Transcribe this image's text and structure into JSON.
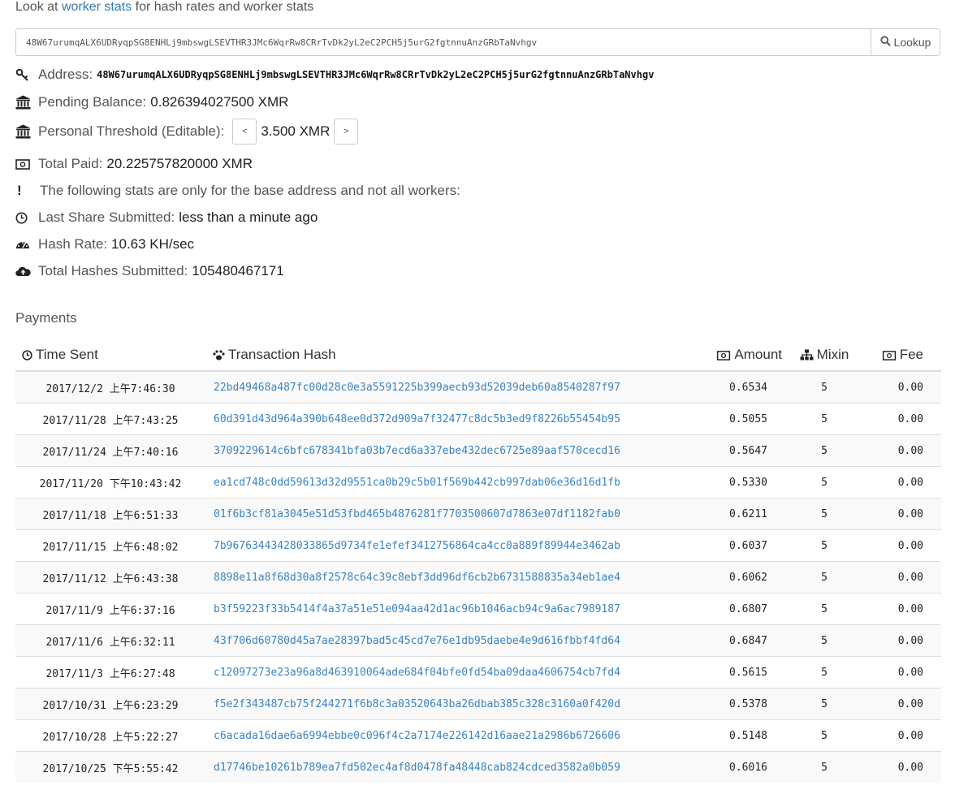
{
  "intro": {
    "prefix": "Look at ",
    "link": "worker stats",
    "suffix": " for hash rates and worker stats"
  },
  "lookup": {
    "value": "48W67urumqALX6UDRyqpSG8ENHLj9mbswgLSEVTHR3JMc6WqrRw8CRrTvDk2yL2eC2PCH5j5urG2fgtnnuAnzGRbTaNvhgv",
    "button_label": "Lookup",
    "icon": "search-icon"
  },
  "stats": {
    "address": {
      "label": "Address:",
      "value": "48W67urumqALX6UDRyqpSG8ENHLj9mbswgLSEVTHR3JMc6WqrRw8CRrTvDk2yL2eC2PCH5j5urG2fgtnnuAnzGRbTaNvhgv",
      "icon": "key-icon"
    },
    "pending": {
      "label": "Pending Balance:",
      "value": "0.826394027500 XMR",
      "icon": "bank-icon"
    },
    "threshold": {
      "label": "Personal Threshold (Editable):",
      "value": "3.500 XMR",
      "dec": "<",
      "inc": ">",
      "icon": "bank-icon"
    },
    "total_paid": {
      "label": "Total Paid:",
      "value": "20.225757820000 XMR",
      "icon": "money-icon"
    },
    "notice": {
      "label": "The following stats are only for the base address and not all workers:",
      "icon": "exclamation-icon"
    },
    "last_share": {
      "label": "Last Share Submitted:",
      "value": "less than a minute ago",
      "icon": "clock-icon"
    },
    "hash_rate": {
      "label": "Hash Rate:",
      "value": "10.63 KH/sec",
      "icon": "dashboard-icon"
    },
    "total_hashes": {
      "label": "Total Hashes Submitted:",
      "value": "105480467171",
      "icon": "cloud-upload-icon"
    }
  },
  "payments": {
    "title": "Payments",
    "headers": {
      "time": "Time Sent",
      "hash": "Transaction Hash",
      "amount": "Amount",
      "mixin": "Mixin",
      "fee": "Fee"
    },
    "rows": [
      {
        "time": "2017/12/2 上午7:46:30",
        "hash": "22bd49468a487fc00d28c0e3a5591225b399aecb93d52039deb60a8540287f97",
        "amount": "0.6534",
        "mixin": "5",
        "fee": "0.00"
      },
      {
        "time": "2017/11/28 上午7:43:25",
        "hash": "60d391d43d964a390b648ee0d372d909a7f32477c8dc5b3ed9f8226b55454b95",
        "amount": "0.5055",
        "mixin": "5",
        "fee": "0.00"
      },
      {
        "time": "2017/11/24 上午7:40:16",
        "hash": "3709229614c6bfc678341bfa03b7ecd6a337ebe432dec6725e89aaf570cecd16",
        "amount": "0.5647",
        "mixin": "5",
        "fee": "0.00"
      },
      {
        "time": "2017/11/20 下午10:43:42",
        "hash": "ea1cd748c0dd59613d32d9551ca0b29c5b01f569b442cb997dab06e36d16d1fb",
        "amount": "0.5330",
        "mixin": "5",
        "fee": "0.00"
      },
      {
        "time": "2017/11/18 上午6:51:33",
        "hash": "01f6b3cf81a3045e51d53fbd465b4876281f7703500607d7863e07df1182fab0",
        "amount": "0.6211",
        "mixin": "5",
        "fee": "0.00"
      },
      {
        "time": "2017/11/15 上午6:48:02",
        "hash": "7b96763443428033865d9734fe1efef3412756864ca4cc0a889f89944e3462ab",
        "amount": "0.6037",
        "mixin": "5",
        "fee": "0.00"
      },
      {
        "time": "2017/11/12 上午6:43:38",
        "hash": "8898e11a8f68d30a8f2578c64c39c8ebf3dd96df6cb2b6731588835a34eb1ae4",
        "amount": "0.6062",
        "mixin": "5",
        "fee": "0.00"
      },
      {
        "time": "2017/11/9 上午6:37:16",
        "hash": "b3f59223f33b5414f4a37a51e51e094aa42d1ac96b1046acb94c9a6ac7989187",
        "amount": "0.6807",
        "mixin": "5",
        "fee": "0.00"
      },
      {
        "time": "2017/11/6 上午6:32:11",
        "hash": "43f706d60780d45a7ae28397bad5c45cd7e76e1db95daebe4e9d616fbbf4fd64",
        "amount": "0.6847",
        "mixin": "5",
        "fee": "0.00"
      },
      {
        "time": "2017/11/3 上午6:27:48",
        "hash": "c12097273e23a96a8d463910064ade684f04bfe0fd54ba09daa4606754cb7fd4",
        "amount": "0.5615",
        "mixin": "5",
        "fee": "0.00"
      },
      {
        "time": "2017/10/31 上午6:23:29",
        "hash": "f5e2f343487cb75f244271f6b8c3a03520643ba26dbab385c328c3160a0f420d",
        "amount": "0.5378",
        "mixin": "5",
        "fee": "0.00"
      },
      {
        "time": "2017/10/28 上午5:22:27",
        "hash": "c6acada16dae6a6994ebbe0c096f4c2a7174e226142d16aae21a2986b6726606",
        "amount": "0.5148",
        "mixin": "5",
        "fee": "0.00"
      },
      {
        "time": "2017/10/25 下午5:55:42",
        "hash": "d17746be10261b789ea7fd502ec4af8d0478fa48448cab824cdced3582a0b059",
        "amount": "0.6016",
        "mixin": "5",
        "fee": "0.00"
      }
    ]
  },
  "colors": {
    "link": "#337ab7",
    "hash_link": "#3a84c2",
    "border": "#dddddd",
    "stripe": "#f9f9f9"
  }
}
